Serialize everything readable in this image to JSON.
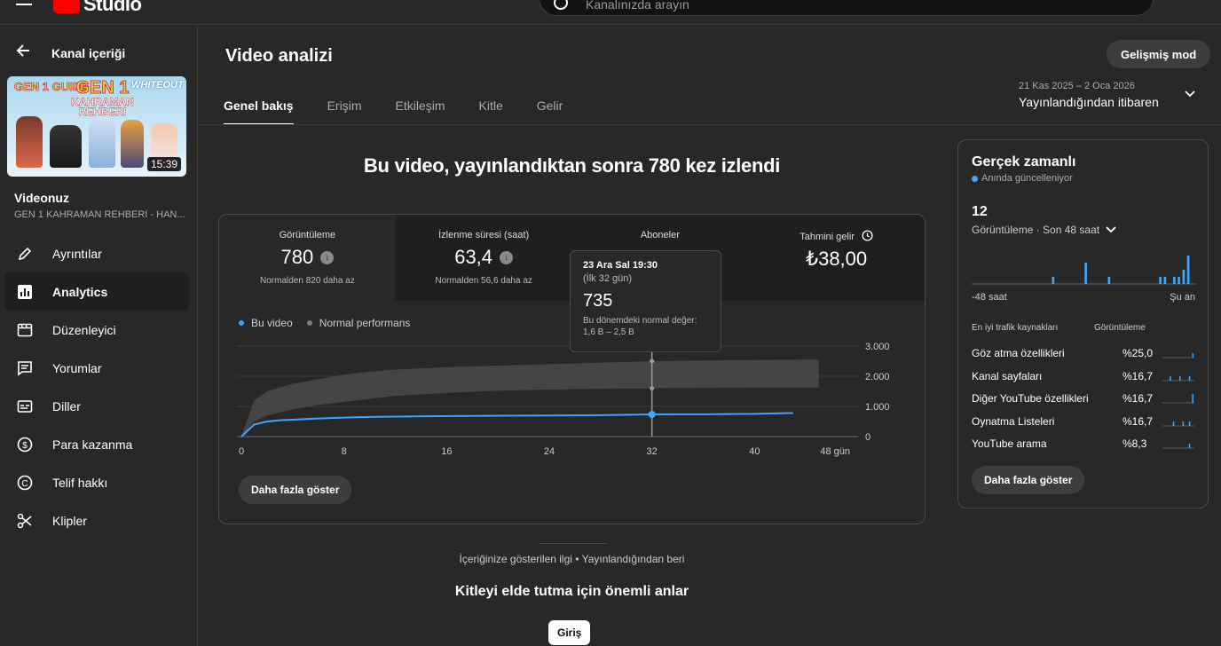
{
  "header": {
    "logo_text": "Studio",
    "search_placeholder": "Kanalınızda arayın"
  },
  "sidebar": {
    "back_label": "Kanal içeriği",
    "thumbnail": {
      "line1": "GEN 1 GUIDE",
      "line2": "GEN 1",
      "line3": "KAHRAMAN REHBERI",
      "badge": "WHITEOUT",
      "duration": "15:39"
    },
    "video_label": "Videonuz",
    "video_title": "GEN 1 KAHRAMAN REHBERİ - HAN...",
    "items": [
      {
        "label": "Ayrıntılar",
        "icon": "pencil-icon"
      },
      {
        "label": "Analytics",
        "icon": "analytics-icon",
        "active": true
      },
      {
        "label": "Düzenleyici",
        "icon": "editor-icon"
      },
      {
        "label": "Yorumlar",
        "icon": "comments-icon"
      },
      {
        "label": "Diller",
        "icon": "subtitles-icon"
      },
      {
        "label": "Para kazanma",
        "icon": "dollar-icon"
      },
      {
        "label": "Telif hakkı",
        "icon": "copyright-icon"
      },
      {
        "label": "Klipler",
        "icon": "scissors-icon"
      }
    ]
  },
  "main": {
    "title": "Video analizi",
    "advanced_button": "Gelişmiş mod",
    "tabs": [
      "Genel bakış",
      "Erişim",
      "Etkileşim",
      "Kitle",
      "Gelir"
    ],
    "date_range": {
      "range": "21 Kas 2025 – 2 Oca 2026",
      "label": "Yayınlandığından itibaren"
    },
    "headline": "Bu video, yayınlandıktan sonra 780 kez izlendi",
    "metrics": [
      {
        "label": "Görüntüleme",
        "value": "780",
        "sub": "Normalden 820 daha az"
      },
      {
        "label": "İzlenme süresi (saat)",
        "value": "63,4",
        "sub": "Normalden 56,6 daha az"
      },
      {
        "label": "Aboneler",
        "value": "",
        "sub": ""
      },
      {
        "label": "Tahmini gelir",
        "value": "₺38,00",
        "sub": ""
      }
    ],
    "legend": {
      "this_video": "Bu video",
      "normal": "Normal performans"
    },
    "more_button": "Daha fazla göster",
    "tooltip": {
      "date": "23 Ara Sal 19:30",
      "period": "(İlk 32 gün)",
      "value": "735",
      "normal_label": "Bu dönemdeki normal değer:",
      "normal_range": "1,6 B – 2,5 B"
    },
    "interest_caption": "İçeriğinize gösterilen ilgi • Yayınlandığından beri",
    "key_moments_title": "Kitleyi elde tutma için önemli anlar",
    "intro_button": "Giriş"
  },
  "realtime": {
    "title": "Gerçek zamanlı",
    "live_text": "Anında güncelleniyor",
    "count": "12",
    "sub": "Görüntüleme · Son 48 saat",
    "axis_left": "-48 saat",
    "axis_right": "Şu an",
    "traffic_header": "En iyi trafik kaynakları",
    "traffic_col": "Görüntüleme",
    "sources": [
      {
        "name": "Göz atma özellikleri",
        "value": "%25,0"
      },
      {
        "name": "Kanal sayfaları",
        "value": "%16,7"
      },
      {
        "name": "Diğer YouTube özellikleri",
        "value": "%16,7"
      },
      {
        "name": "Oynatma Listeleri",
        "value": "%16,7"
      },
      {
        "name": "YouTube arama",
        "value": "%8,3"
      }
    ],
    "more_button": "Daha fazla göster",
    "bars": [
      0,
      0,
      0,
      0,
      0,
      0,
      0,
      0,
      0,
      0,
      0,
      0,
      0,
      0,
      0,
      0,
      0,
      1,
      0,
      0,
      0,
      0,
      0,
      0,
      3,
      0,
      0,
      0,
      0,
      1,
      0,
      0,
      0,
      0,
      0,
      0,
      0,
      0,
      0,
      0,
      1,
      1,
      0,
      1,
      1,
      2,
      4,
      0
    ]
  },
  "colors": {
    "accent": "#3ea6ff",
    "band": "#4a4a4a",
    "background": "#282828"
  },
  "chart_data": {
    "type": "line",
    "x_ticks": [
      "0",
      "8",
      "16",
      "24",
      "32",
      "40",
      "48 gün"
    ],
    "y_ticks": [
      "0",
      "1.000",
      "2.000",
      "3.000"
    ],
    "ylim": [
      0,
      3000
    ],
    "xlim": [
      0,
      48
    ],
    "series": [
      {
        "name": "Bu video",
        "x": [
          0,
          1,
          2,
          3,
          4,
          5,
          6,
          8,
          10,
          12,
          16,
          20,
          24,
          28,
          32,
          36,
          40,
          43
        ],
        "values": [
          0,
          400,
          500,
          540,
          560,
          580,
          600,
          630,
          650,
          660,
          680,
          690,
          700,
          710,
          735,
          740,
          755,
          780
        ]
      },
      {
        "name": "Normal performans",
        "band": true,
        "x": [
          0,
          1,
          2,
          4,
          6,
          8,
          10,
          12,
          16,
          20,
          24,
          28,
          32,
          36,
          40,
          45
        ],
        "low": [
          0,
          500,
          700,
          900,
          1050,
          1150,
          1250,
          1350,
          1450,
          1520,
          1560,
          1580,
          1600,
          1610,
          1620,
          1620
        ],
        "high": [
          0,
          1200,
          1500,
          1750,
          1900,
          2050,
          2150,
          2220,
          2300,
          2350,
          2400,
          2450,
          2500,
          2520,
          2540,
          2550
        ]
      }
    ]
  }
}
